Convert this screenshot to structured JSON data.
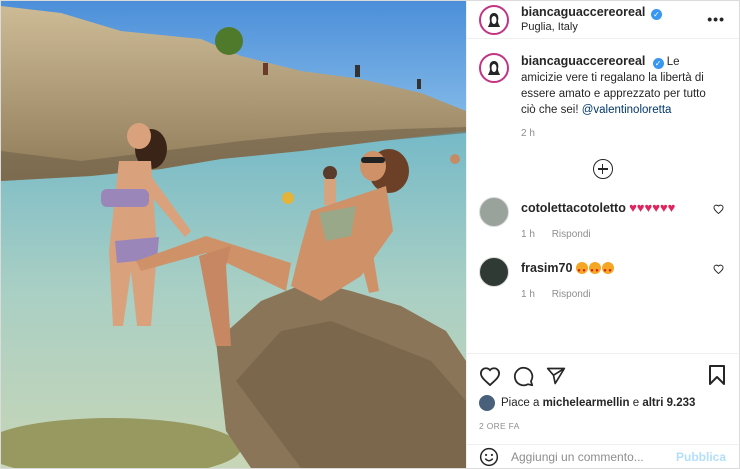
{
  "post": {
    "username": "biancaguaccereoreal",
    "location": "Puglia, Italy",
    "more_label": "•••",
    "verified_mark": "✓",
    "caption_text": "Le amicizie vere ti regalano la libertà di essere amato e apprezzato per tutto ciò che sei!",
    "caption_mention": "@valentinoloretta",
    "caption_time": "2 h"
  },
  "comments": [
    {
      "username": "cotolettacotoletto",
      "hearts": "♥♥♥♥♥♥",
      "time": "1 h",
      "reply": "Rispondi"
    },
    {
      "username": "frasim70",
      "time": "1 h",
      "reply": "Rispondi"
    }
  ],
  "likes": {
    "prefix": "Piace a",
    "user": "michelearmellin",
    "middle": "e",
    "others": "altri 9.233"
  },
  "post_time": "2 ORE FA",
  "add_comment": {
    "placeholder": "Aggiungi un commento...",
    "publish_label": "Pubblica"
  },
  "icons": [
    "heart-icon",
    "comment-icon",
    "share-icon",
    "save-icon",
    "emoji-icon",
    "plus-circle-icon",
    "more-icon",
    "verified-icon"
  ],
  "colors": {
    "link": "#00376b",
    "verified": "#3897f0",
    "publish": "#b2dffc",
    "heart": "#e0245e"
  }
}
